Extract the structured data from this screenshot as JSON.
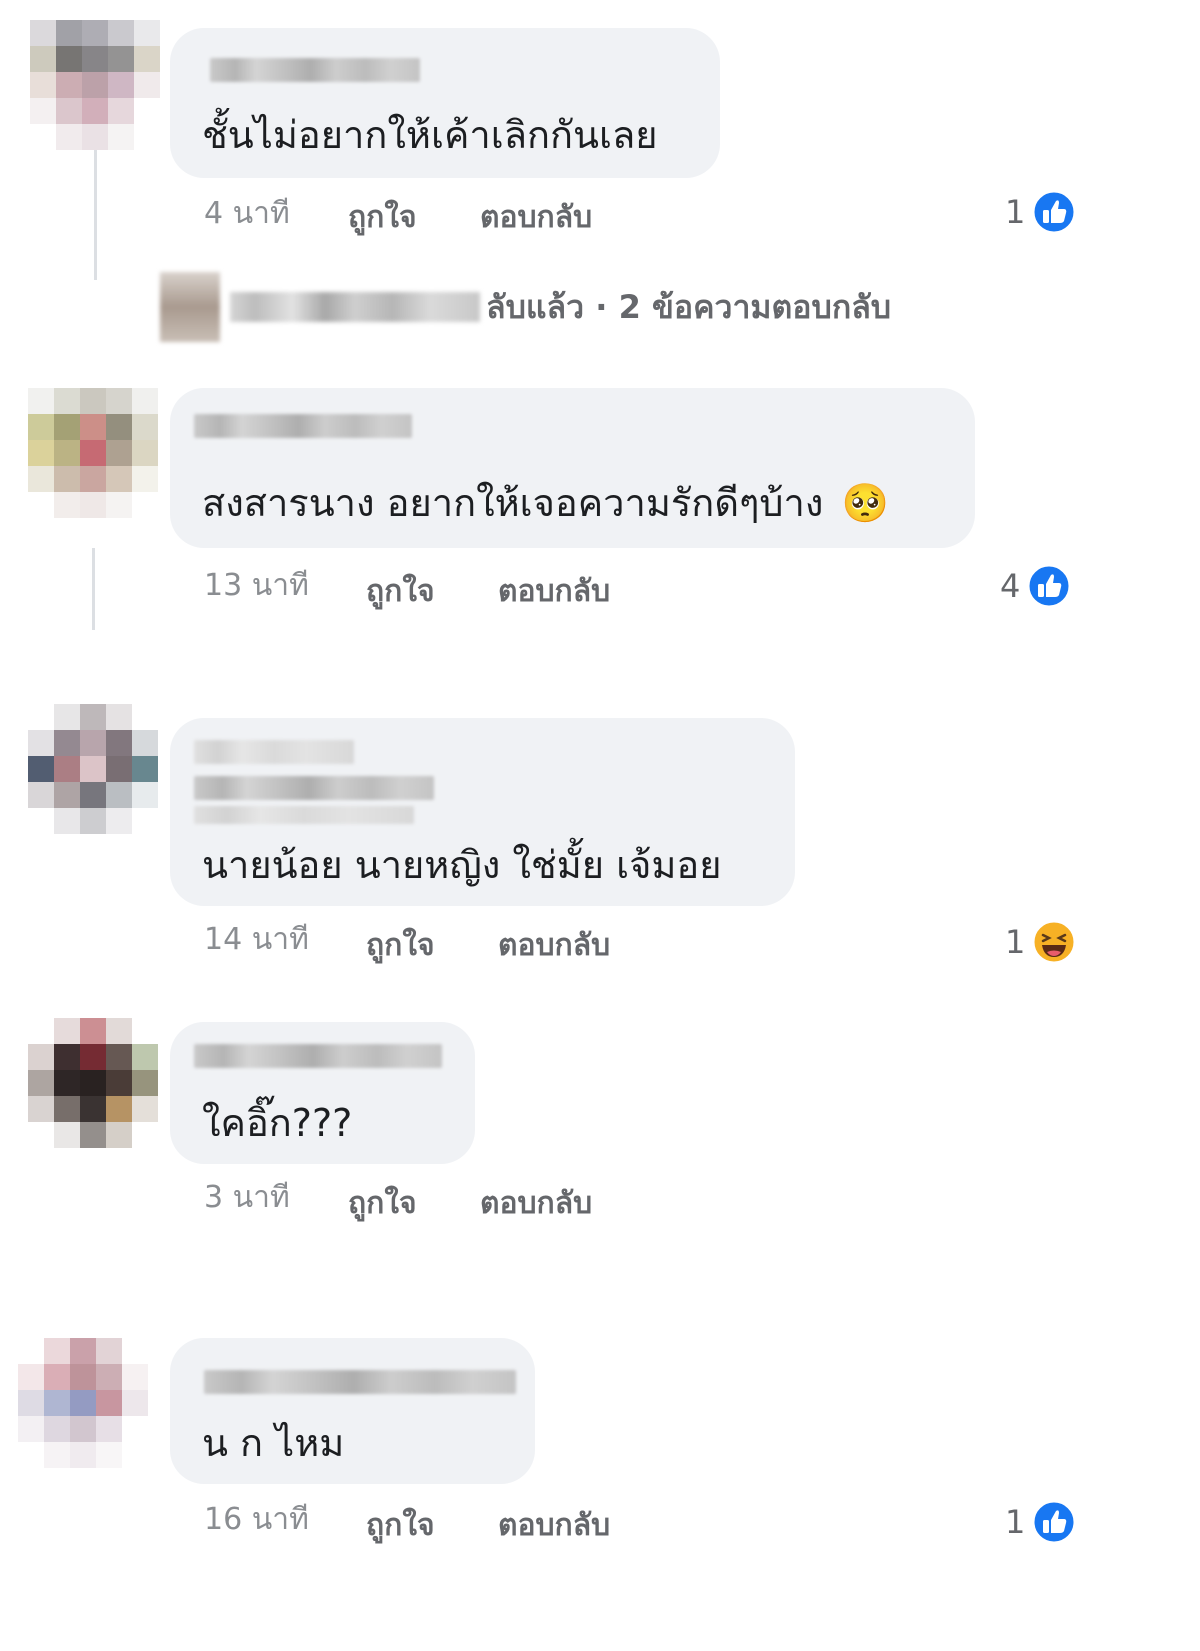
{
  "colors": {
    "like_blue": "#1877f2",
    "haha_yellow": "#f7b125",
    "bubble_bg": "#f0f2f5",
    "meta_text": "#65676b"
  },
  "comments": [
    {
      "text": "ชั้นไม่อยากให้เค้าเลิกกันเลย",
      "time": "4 นาที",
      "like_label": "ถูกใจ",
      "reply_label": "ตอบกลับ",
      "reaction_count": "1",
      "reaction_icon": "like-thumb-icon",
      "replies_text": "ลับแล้ว · 2 ข้อความตอบกลับ"
    },
    {
      "text": "สงสารนาง อยากให้เจอความรักดีๆบ้าง",
      "emoji": "🥺",
      "time": "13 นาที",
      "like_label": "ถูกใจ",
      "reply_label": "ตอบกลับ",
      "reaction_count": "4",
      "reaction_icon": "like-thumb-icon"
    },
    {
      "text": "นายน้อย นายหญิง ใช่มั้ย เจ้มอย",
      "time": "14 นาที",
      "like_label": "ถูกใจ",
      "reply_label": "ตอบกลับ",
      "reaction_count": "1",
      "reaction_icon": "haha-face-icon"
    },
    {
      "text": "ใคอิ๊ก???",
      "time": "3 นาที",
      "like_label": "ถูกใจ",
      "reply_label": "ตอบกลับ"
    },
    {
      "text": "น ก ไหม",
      "time": "16 นาที",
      "like_label": "ถูกใจ",
      "reply_label": "ตอบกลับ",
      "reaction_count": "1",
      "reaction_icon": "like-thumb-icon"
    }
  ]
}
